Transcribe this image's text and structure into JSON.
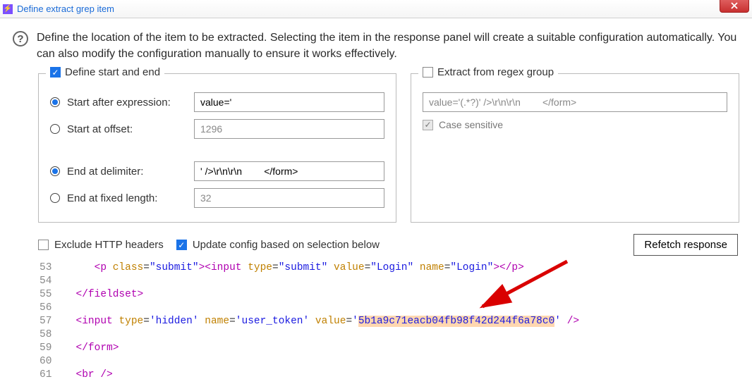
{
  "window": {
    "title": "Define extract grep item"
  },
  "description": "Define the location of the item to be extracted. Selecting the item in the response panel will create a suitable configuration automatically. You can also modify the configuration manually to ensure it works effectively.",
  "left_panel": {
    "legend": "Define start and end",
    "legend_checked": true,
    "start_after_label": "Start after expression:",
    "start_after_value": "value='",
    "start_offset_label": "Start at offset:",
    "start_offset_value": "1296",
    "end_delim_label": "End at delimiter:",
    "end_delim_value": "' />\\r\\n\\r\\n        </form>",
    "end_fixed_label": "End at fixed length:",
    "end_fixed_value": "32"
  },
  "right_panel": {
    "legend": "Extract from regex group",
    "regex_value": "value='(.*?)' />\\r\\n\\r\\n        </form>",
    "case_label": "Case sensitive"
  },
  "options": {
    "exclude_label": "Exclude HTTP headers",
    "update_label": "Update config based on selection below",
    "refetch_label": "Refetch response"
  },
  "code": {
    "line_start": 53,
    "token_value": "5b1a9c71eacb04fb98f42d244f6a78c0"
  }
}
